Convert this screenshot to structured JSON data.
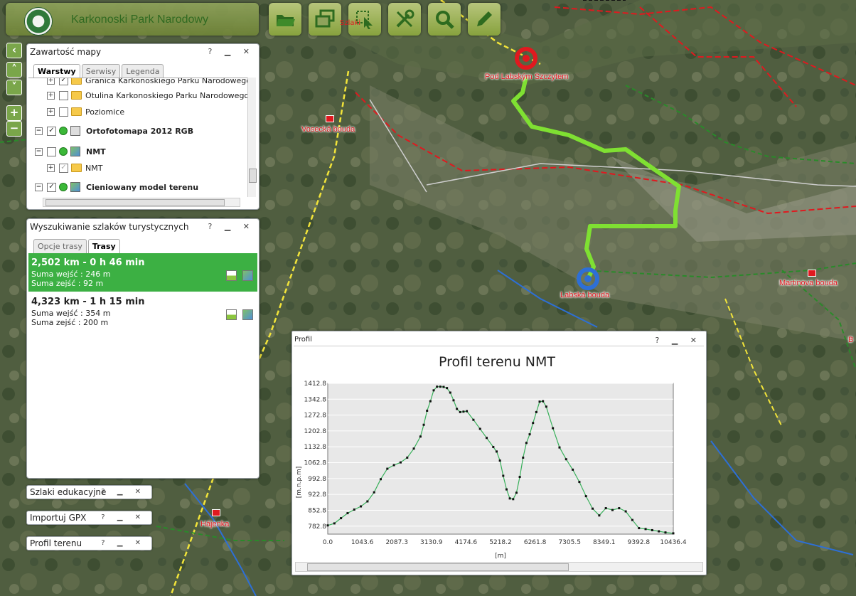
{
  "app": {
    "title": "Karkonoski Park Narodowy"
  },
  "toolbar": {
    "buttons": [
      {
        "name": "open-folder",
        "icon": "folder-icon"
      },
      {
        "name": "windows",
        "icon": "windows-icon"
      },
      {
        "name": "select",
        "icon": "select-icon",
        "label": "Szlaki"
      },
      {
        "name": "tools",
        "icon": "tools-icon"
      },
      {
        "name": "search",
        "icon": "magnifier-icon"
      },
      {
        "name": "edit",
        "icon": "pencil-icon"
      }
    ]
  },
  "nav": {
    "left": "‹",
    "up": "˄",
    "down": "˅",
    "zoom_in": "+",
    "zoom_out": "−"
  },
  "map_labels": {
    "pod_labskim": "Pod Labským Szczytem",
    "vosecka": "Vosecká bouda",
    "labska": "Labská bouda",
    "martinova": "Martinova bouda",
    "hajenka": "Hájenka",
    "edge_b": "B"
  },
  "contents_panel": {
    "title": "Zawartość mapy",
    "tabs": [
      "Warstwy",
      "Serwisy",
      "Legenda"
    ],
    "layers": [
      {
        "label": "Granica Karkonoskiego Parku Narodowego",
        "checked": true,
        "type": "folder",
        "level": 1
      },
      {
        "label": "Otulina Karkonoskiego Parku Narodowego",
        "checked": false,
        "type": "folder",
        "level": 1
      },
      {
        "label": "Poziomice",
        "checked": false,
        "type": "folder",
        "level": 1
      },
      {
        "label": "Ortofotomapa 2012 RGB",
        "checked": true,
        "type": "service",
        "level": 0
      },
      {
        "label": "NMT",
        "checked": false,
        "type": "service",
        "level": 0
      },
      {
        "label": "NMT",
        "checked": true,
        "type": "folder",
        "level": 1
      },
      {
        "label": "Cieniowany model terenu",
        "checked": true,
        "type": "service",
        "level": 0
      }
    ]
  },
  "routes_panel": {
    "title": "Wyszukiwanie szlaków turystycznych",
    "tabs": [
      "Opcje trasy",
      "Trasy"
    ],
    "routes": [
      {
        "title": "2,502 km - 0 h 46 min",
        "up": "Suma wejść : 246 m",
        "down": "Suma zejść : 92 m",
        "selected": true
      },
      {
        "title": "4,323 km - 1 h 15 min",
        "up": "Suma wejść : 354 m",
        "down": "Suma zejść : 200 m",
        "selected": false
      }
    ]
  },
  "collapsed_panels": [
    "Szlaki edukacyjne",
    "Importuj GPX",
    "Profil terenu"
  ],
  "window_buttons": "? ▁ ✕",
  "profile_window": {
    "title": "Profil"
  },
  "chart_data": {
    "type": "line",
    "title": "Profil terenu NMT",
    "xlabel": "[m]",
    "ylabel": "[m.n.p.m]",
    "xlim": [
      0,
      10436.4
    ],
    "ylim": [
      747.6,
      1412.8
    ],
    "x_ticks": [
      "0.0",
      "1043.6",
      "2087.3",
      "3130.9",
      "4174.6",
      "5218.2",
      "6261.8",
      "7305.5",
      "8349.1",
      "9392.8",
      "10436.4"
    ],
    "y_ticks": [
      "1412.8",
      "1342.8",
      "1272.8",
      "1202.8",
      "1132.8",
      "1062.8",
      "992.8",
      "922.8",
      "852.8",
      "782.8"
    ],
    "grid": true,
    "line_color": "#38b05a",
    "marker_color": "#111111",
    "series": [
      {
        "x": [
          0,
          200,
          400,
          600,
          800,
          1000,
          1200,
          1400,
          1600,
          1800,
          2000,
          2200,
          2400,
          2600,
          2800,
          2900,
          3000,
          3100,
          3200,
          3300,
          3400,
          3500,
          3600,
          3700,
          3800,
          3900,
          4000,
          4100,
          4200,
          4400,
          4600,
          4800,
          5000,
          5100,
          5200,
          5300,
          5400,
          5500,
          5600,
          5700,
          5800,
          5900,
          6000,
          6100,
          6200,
          6300,
          6400,
          6500,
          6600,
          6800,
          7000,
          7200,
          7400,
          7600,
          7800,
          8000,
          8200,
          8400,
          8600,
          8800,
          9000,
          9200,
          9400,
          9600,
          9800,
          10000,
          10200,
          10436
        ],
        "y": [
          786,
          795,
          818,
          840,
          856,
          870,
          892,
          932,
          990,
          1036,
          1052,
          1064,
          1085,
          1125,
          1178,
          1230,
          1292,
          1334,
          1382,
          1398,
          1398,
          1397,
          1392,
          1372,
          1338,
          1300,
          1286,
          1288,
          1290,
          1252,
          1212,
          1172,
          1132,
          1112,
          1072,
          1005,
          945,
          905,
          902,
          930,
          1000,
          1085,
          1150,
          1188,
          1238,
          1286,
          1332,
          1334,
          1310,
          1215,
          1130,
          1078,
          1032,
          978,
          915,
          860,
          830,
          862,
          854,
          862,
          848,
          810,
          774,
          770,
          765,
          760,
          755,
          751
        ]
      }
    ]
  }
}
